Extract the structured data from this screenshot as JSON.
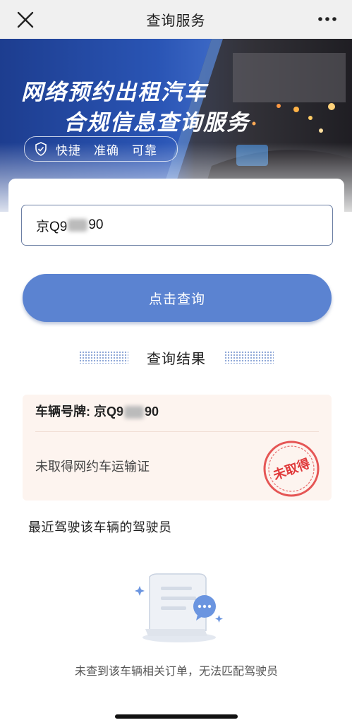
{
  "nav": {
    "title": "查询服务",
    "close_icon": "close-icon",
    "more_icon": "more-icon"
  },
  "banner": {
    "title_line1": "网络预约出租汽车",
    "title_line2": "合规信息查询服务",
    "tags": [
      "快捷",
      "准确",
      "可靠"
    ]
  },
  "search": {
    "plate_prefix": "京Q9",
    "plate_suffix": "90"
  },
  "query_button": {
    "label": "点击查询"
  },
  "results": {
    "section_title": "查询结果",
    "plate_label": "车辆号牌: ",
    "plate_prefix": "京Q9",
    "plate_suffix": "90",
    "status": "未取得网约车运输证",
    "stamp_text": "未取得"
  },
  "drivers": {
    "title": "最近驾驶该车辆的驾驶员",
    "empty_text": "未查到该车辆相关订单，无法匹配驾驶员"
  },
  "colors": {
    "primary": "#5b83d1",
    "stamp_red": "#e0393a",
    "result_bg": "#fdf4ef"
  }
}
